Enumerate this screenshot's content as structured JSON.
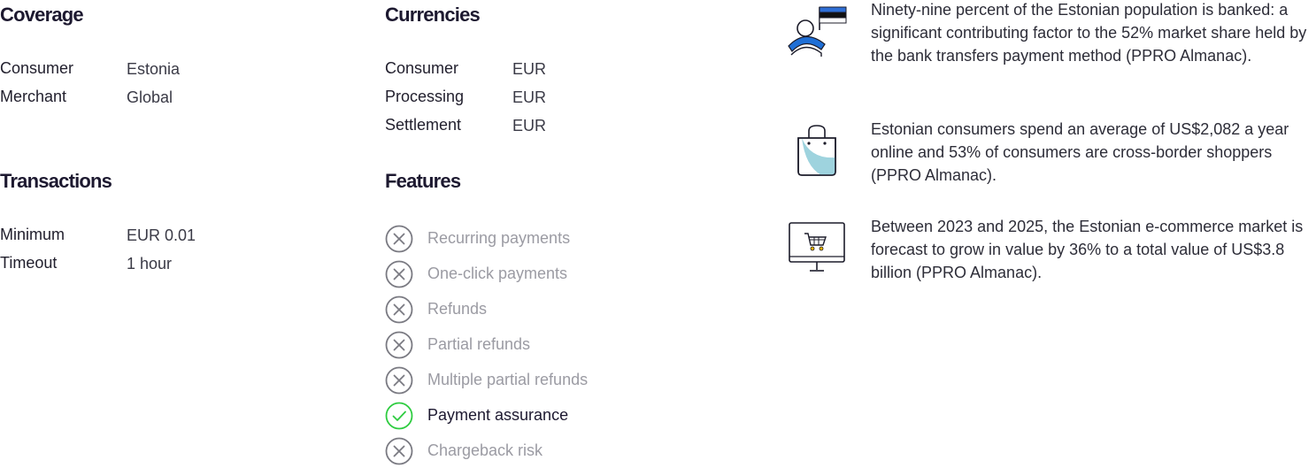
{
  "coverage": {
    "title": "Coverage",
    "rows": [
      {
        "label": "Consumer",
        "value": "Estonia"
      },
      {
        "label": "Merchant",
        "value": "Global"
      }
    ]
  },
  "currencies": {
    "title": "Currencies",
    "rows": [
      {
        "label": "Consumer",
        "value": "EUR"
      },
      {
        "label": "Processing",
        "value": "EUR"
      },
      {
        "label": "Settlement",
        "value": "EUR"
      }
    ]
  },
  "transactions": {
    "title": "Transactions",
    "rows": [
      {
        "label": "Minimum",
        "value": "EUR 0.01"
      },
      {
        "label": "Timeout",
        "value": "1 hour"
      }
    ]
  },
  "features": {
    "title": "Features",
    "items": [
      {
        "label": "Recurring payments",
        "supported": false
      },
      {
        "label": "One-click payments",
        "supported": false
      },
      {
        "label": "Refunds",
        "supported": false
      },
      {
        "label": "Partial refunds",
        "supported": false
      },
      {
        "label": "Multiple partial refunds",
        "supported": false
      },
      {
        "label": "Payment assurance",
        "supported": true
      },
      {
        "label": "Chargeback risk",
        "supported": false
      }
    ]
  },
  "facts": [
    {
      "icon": "person-flag-icon",
      "text": "Ninety-nine percent of the Estonian population is banked: a significant contributing factor to the 52% market share held by the bank transfers payment method (PPRO Almanac)."
    },
    {
      "icon": "shopping-bag-icon",
      "text": "Estonian consumers spend an average of US$2,082 a year online and 53% of consumers are cross-border shoppers (PPRO Almanac)."
    },
    {
      "icon": "monitor-cart-icon",
      "text": "Between 2023 and 2025, the Estonian e-commerce market is forecast to grow in value by 36% to a total value of US$3.8 billion (PPRO Almanac)."
    }
  ],
  "colors": {
    "supported": "#2ecc40",
    "unsupported": "#7a7a82",
    "accent_blue": "#1f6fd6",
    "accent_teal": "#9ed3de"
  }
}
